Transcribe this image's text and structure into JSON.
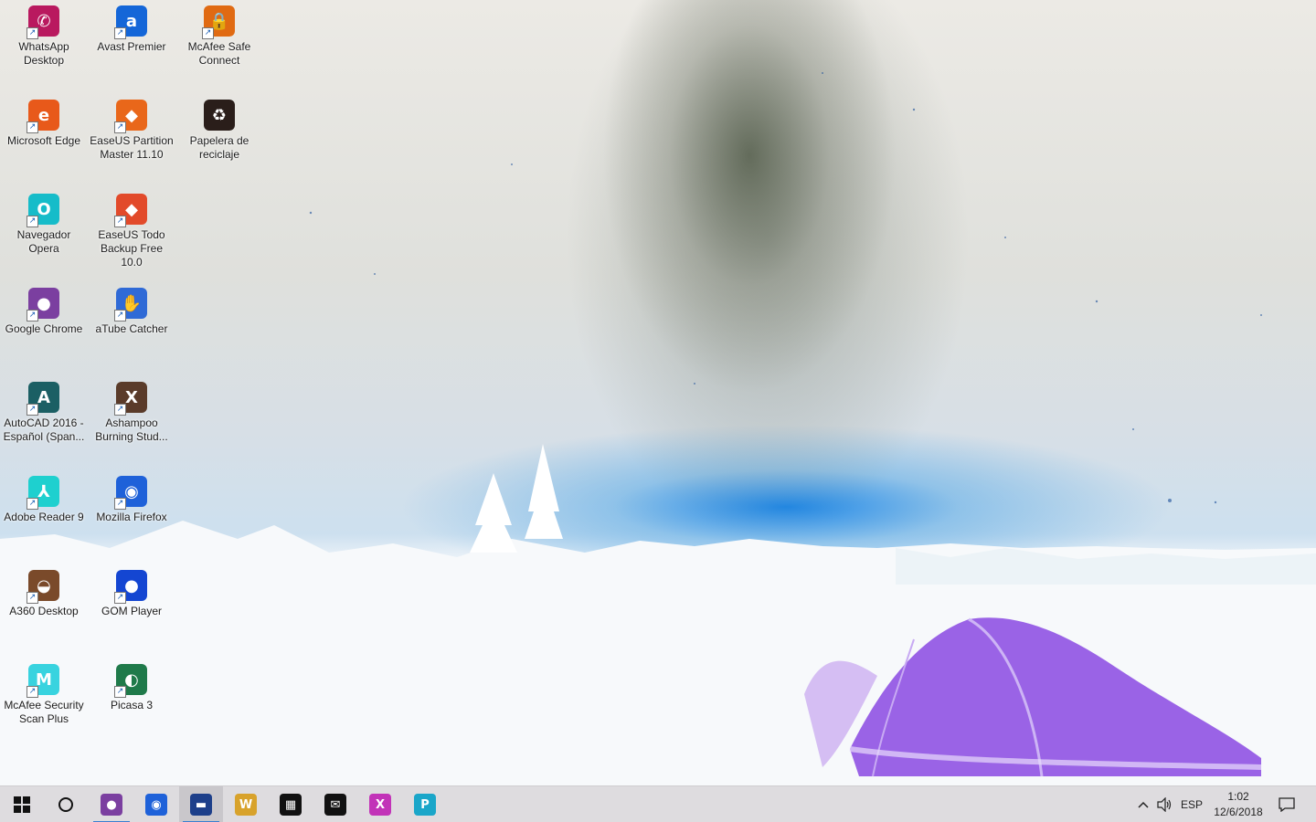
{
  "desktop": {
    "icons": [
      {
        "label": "WhatsApp Desktop",
        "icon": "whatsapp-icon",
        "color": "#b9195f",
        "glyph": "✆"
      },
      {
        "label": "Microsoft Edge",
        "icon": "edge-icon",
        "color": "#e8591a",
        "glyph": "e"
      },
      {
        "label": "Navegador Opera",
        "icon": "opera-icon",
        "color": "#16bcc9",
        "glyph": "O"
      },
      {
        "label": "Google Chrome",
        "icon": "chrome-icon",
        "color": "#7b3fa0",
        "glyph": "●"
      },
      {
        "label": "AutoCAD 2016 - Español (Span...",
        "icon": "autocad-icon",
        "color": "#1b5f64",
        "glyph": "A"
      },
      {
        "label": "Adobe Reader 9",
        "icon": "adobe-reader-icon",
        "color": "#1ed0cf",
        "glyph": "⅄"
      },
      {
        "label": "A360 Desktop",
        "icon": "a360-icon",
        "color": "#7a4a2a",
        "glyph": "◒"
      },
      {
        "label": "McAfee Security Scan Plus",
        "icon": "mcafee-scan-icon",
        "color": "#38d3df",
        "glyph": "M"
      },
      {
        "label": "Avast Premier",
        "icon": "avast-icon",
        "color": "#1466d8",
        "glyph": "a"
      },
      {
        "label": "EaseUS Partition Master 11.10",
        "icon": "easeus-partition-icon",
        "color": "#e9671a",
        "glyph": "◆"
      },
      {
        "label": "EaseUS Todo Backup Free 10.0",
        "icon": "easeus-backup-icon",
        "color": "#e24a2a",
        "glyph": "◆"
      },
      {
        "label": "aTube Catcher",
        "icon": "atube-catcher-icon",
        "color": "#2f6ad6",
        "glyph": "✋"
      },
      {
        "label": "Ashampoo Burning Stud...",
        "icon": "ashampoo-icon",
        "color": "#5a3b2a",
        "glyph": "X"
      },
      {
        "label": "Mozilla Firefox",
        "icon": "firefox-icon",
        "color": "#1e61d9",
        "glyph": "◉"
      },
      {
        "label": "GOM Player",
        "icon": "gom-player-icon",
        "color": "#1446d2",
        "glyph": "●"
      },
      {
        "label": "Picasa 3",
        "icon": "picasa-icon",
        "color": "#1f7a4a",
        "glyph": "◐"
      },
      {
        "label": "McAfee Safe Connect",
        "icon": "mcafee-safe-connect-icon",
        "color": "#e06a12",
        "glyph": "🔒"
      },
      {
        "label": "Papelera de reciclaje",
        "icon": "recycle-bin-icon",
        "color": "#2a1e1a",
        "glyph": "♻"
      }
    ]
  },
  "taskbar": {
    "start_icon": "windows-start-icon",
    "search_icon": "cortana-search-icon",
    "pinned": [
      {
        "icon": "chrome-icon",
        "color": "#7b3fa0",
        "glyph": "●",
        "active": false,
        "running": true
      },
      {
        "icon": "firefox-icon",
        "color": "#1e61d9",
        "glyph": "◉",
        "active": false,
        "running": false
      },
      {
        "icon": "file-explorer-icon",
        "color": "#1d3f8a",
        "glyph": "▬",
        "active": true,
        "running": true
      },
      {
        "icon": "word-icon",
        "color": "#d8a22b",
        "glyph": "W",
        "active": false,
        "running": false
      },
      {
        "icon": "store-icon",
        "color": "#111111",
        "glyph": "▦",
        "active": false,
        "running": false
      },
      {
        "icon": "mail-icon",
        "color": "#111111",
        "glyph": "✉",
        "active": false,
        "running": false
      },
      {
        "icon": "excel-icon",
        "color": "#c233b8",
        "glyph": "X",
        "active": false,
        "running": false
      },
      {
        "icon": "publisher-icon",
        "color": "#1aa6c9",
        "glyph": "P",
        "active": false,
        "running": false
      }
    ],
    "tray": {
      "show_hidden_icon": "chevron-up-icon",
      "volume_icon": "volume-icon",
      "language": "ESP",
      "time": "1:02",
      "date": "12/6/2018",
      "notifications_icon": "action-center-icon"
    }
  }
}
